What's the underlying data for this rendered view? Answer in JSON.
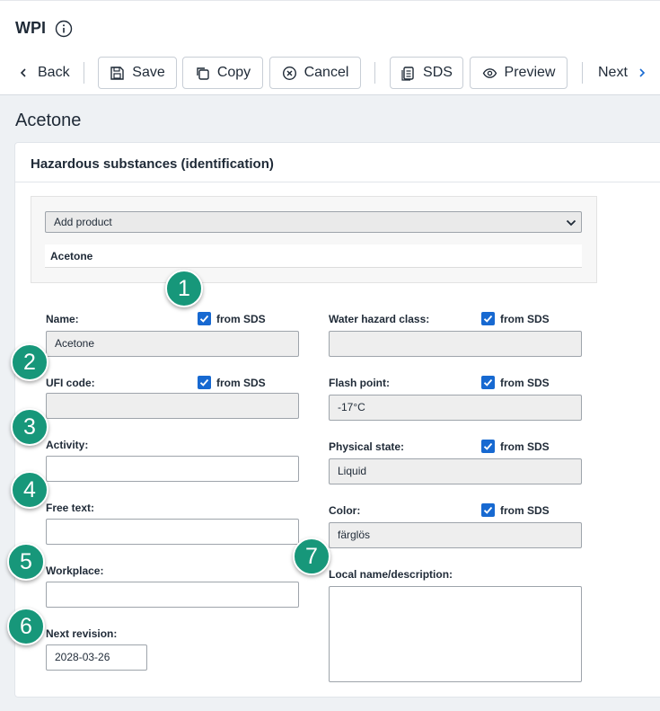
{
  "header": {
    "title": "WPI",
    "info_icon": "info-circle-icon"
  },
  "toolbar": {
    "back_label": "Back",
    "save_label": "Save",
    "copy_label": "Copy",
    "cancel_label": "Cancel",
    "sds_label": "SDS",
    "preview_label": "Preview",
    "next_label": "Next"
  },
  "page": {
    "heading": "Acetone"
  },
  "section": {
    "title": "Hazardous substances (identification)"
  },
  "product": {
    "select_value": "Add product",
    "selected_name": "Acetone"
  },
  "fields": {
    "from_sds_label": "from SDS",
    "name": {
      "label": "Name:",
      "value": "Acetone"
    },
    "ufi": {
      "label": "UFI code:",
      "value": ""
    },
    "activity": {
      "label": "Activity:",
      "value": ""
    },
    "free_text": {
      "label": "Free text:",
      "value": ""
    },
    "workplace": {
      "label": "Workplace:",
      "value": ""
    },
    "next_revision": {
      "label": "Next revision:",
      "value": "2028-03-26"
    },
    "water_hazard": {
      "label": "Water hazard class:",
      "value": ""
    },
    "flash_point": {
      "label": "Flash point:",
      "value": "-17°C"
    },
    "physical_state": {
      "label": "Physical state:",
      "value": "Liquid"
    },
    "color": {
      "label": "Color:",
      "value": "färglös"
    },
    "local_name": {
      "label": "Local name/description:",
      "value": ""
    }
  },
  "badges": [
    "1",
    "2",
    "3",
    "4",
    "5",
    "6",
    "7"
  ],
  "colors": {
    "accent": "#1769d1",
    "badge": "#17977a"
  }
}
